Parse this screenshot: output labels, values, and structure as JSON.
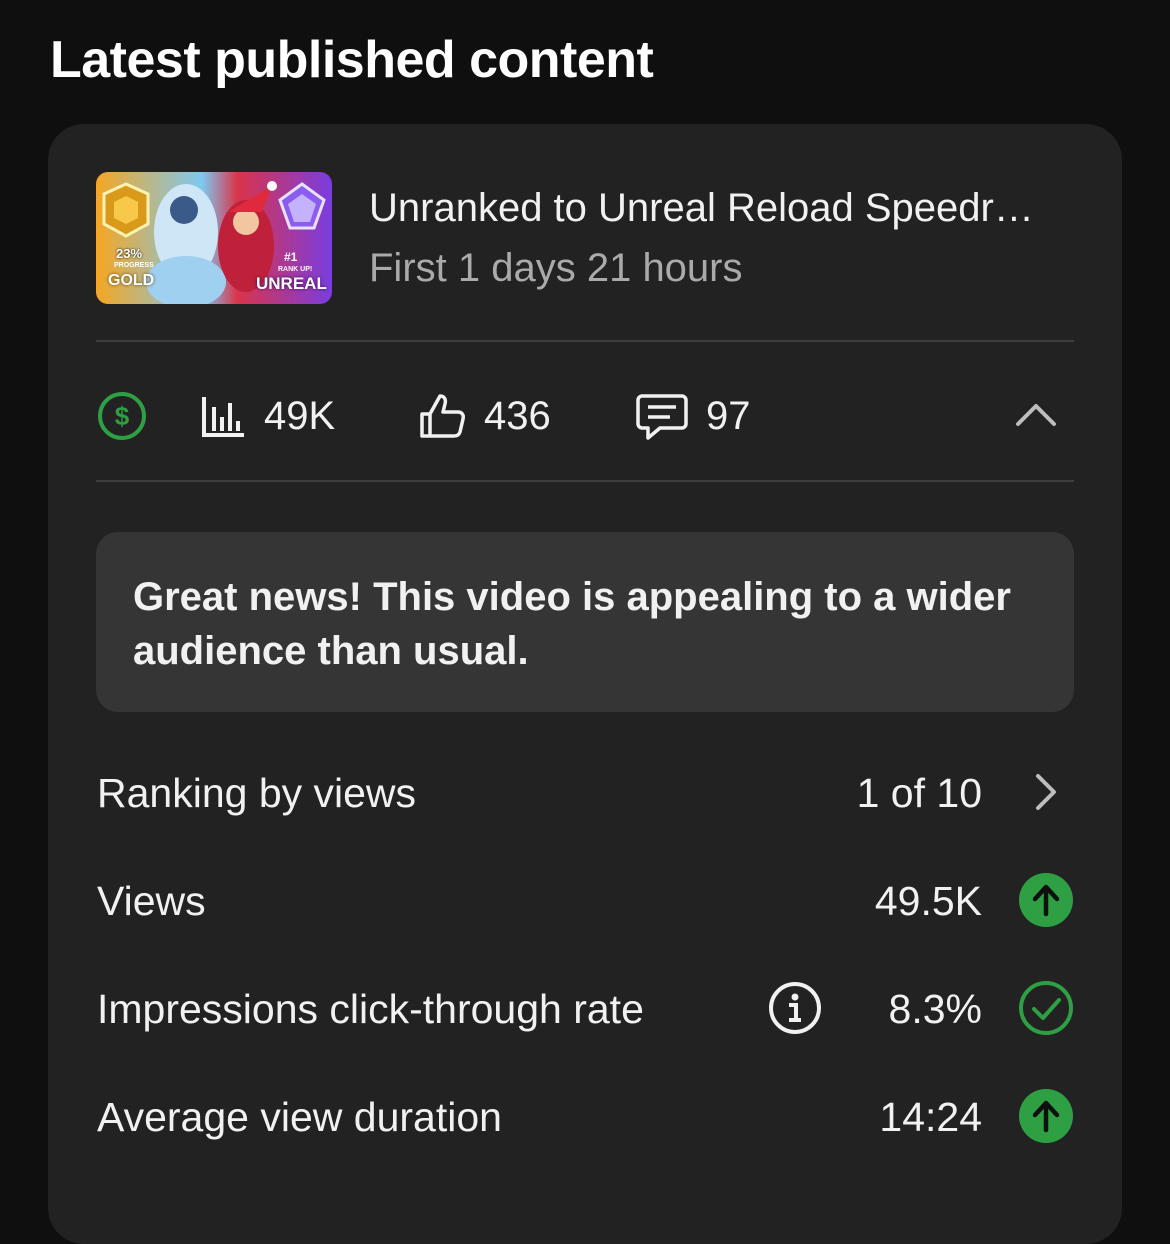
{
  "section": {
    "title": "Latest published content"
  },
  "video": {
    "title": "Unranked to Unreal Reload Speedr…",
    "subtitle": "First 1 days 21 hours",
    "thumbnail": {
      "left_badge_text": "23%",
      "left_badge_sub": "PROGRESS",
      "left_rank": "GOLD",
      "right_badge_text": "#1",
      "right_badge_sub": "RANK UP!",
      "right_rank": "UNREAL"
    }
  },
  "stats": {
    "monetization_icon": "dollar-circle-icon",
    "views": "49K",
    "likes": "436",
    "comments": "97",
    "collapse_icon": "chevron-up-icon"
  },
  "banner": {
    "text": "Great news! This video is appealing to a wider audience than usual."
  },
  "metrics": [
    {
      "label": "Ranking by views",
      "value": "1 of 10",
      "icon": "chevron-right-icon"
    },
    {
      "label": "Views",
      "value": "49.5K",
      "icon": "arrow-up-circle-icon"
    },
    {
      "label": "Impressions click-through rate",
      "value": "8.3%",
      "icon": "check-circle-icon",
      "info_icon": "info-icon"
    },
    {
      "label": "Average view duration",
      "value": "14:24",
      "icon": "arrow-up-circle-icon"
    }
  ],
  "colors": {
    "accent_green": "#2ea043",
    "card_bg": "#222222",
    "banner_bg": "#353535"
  }
}
